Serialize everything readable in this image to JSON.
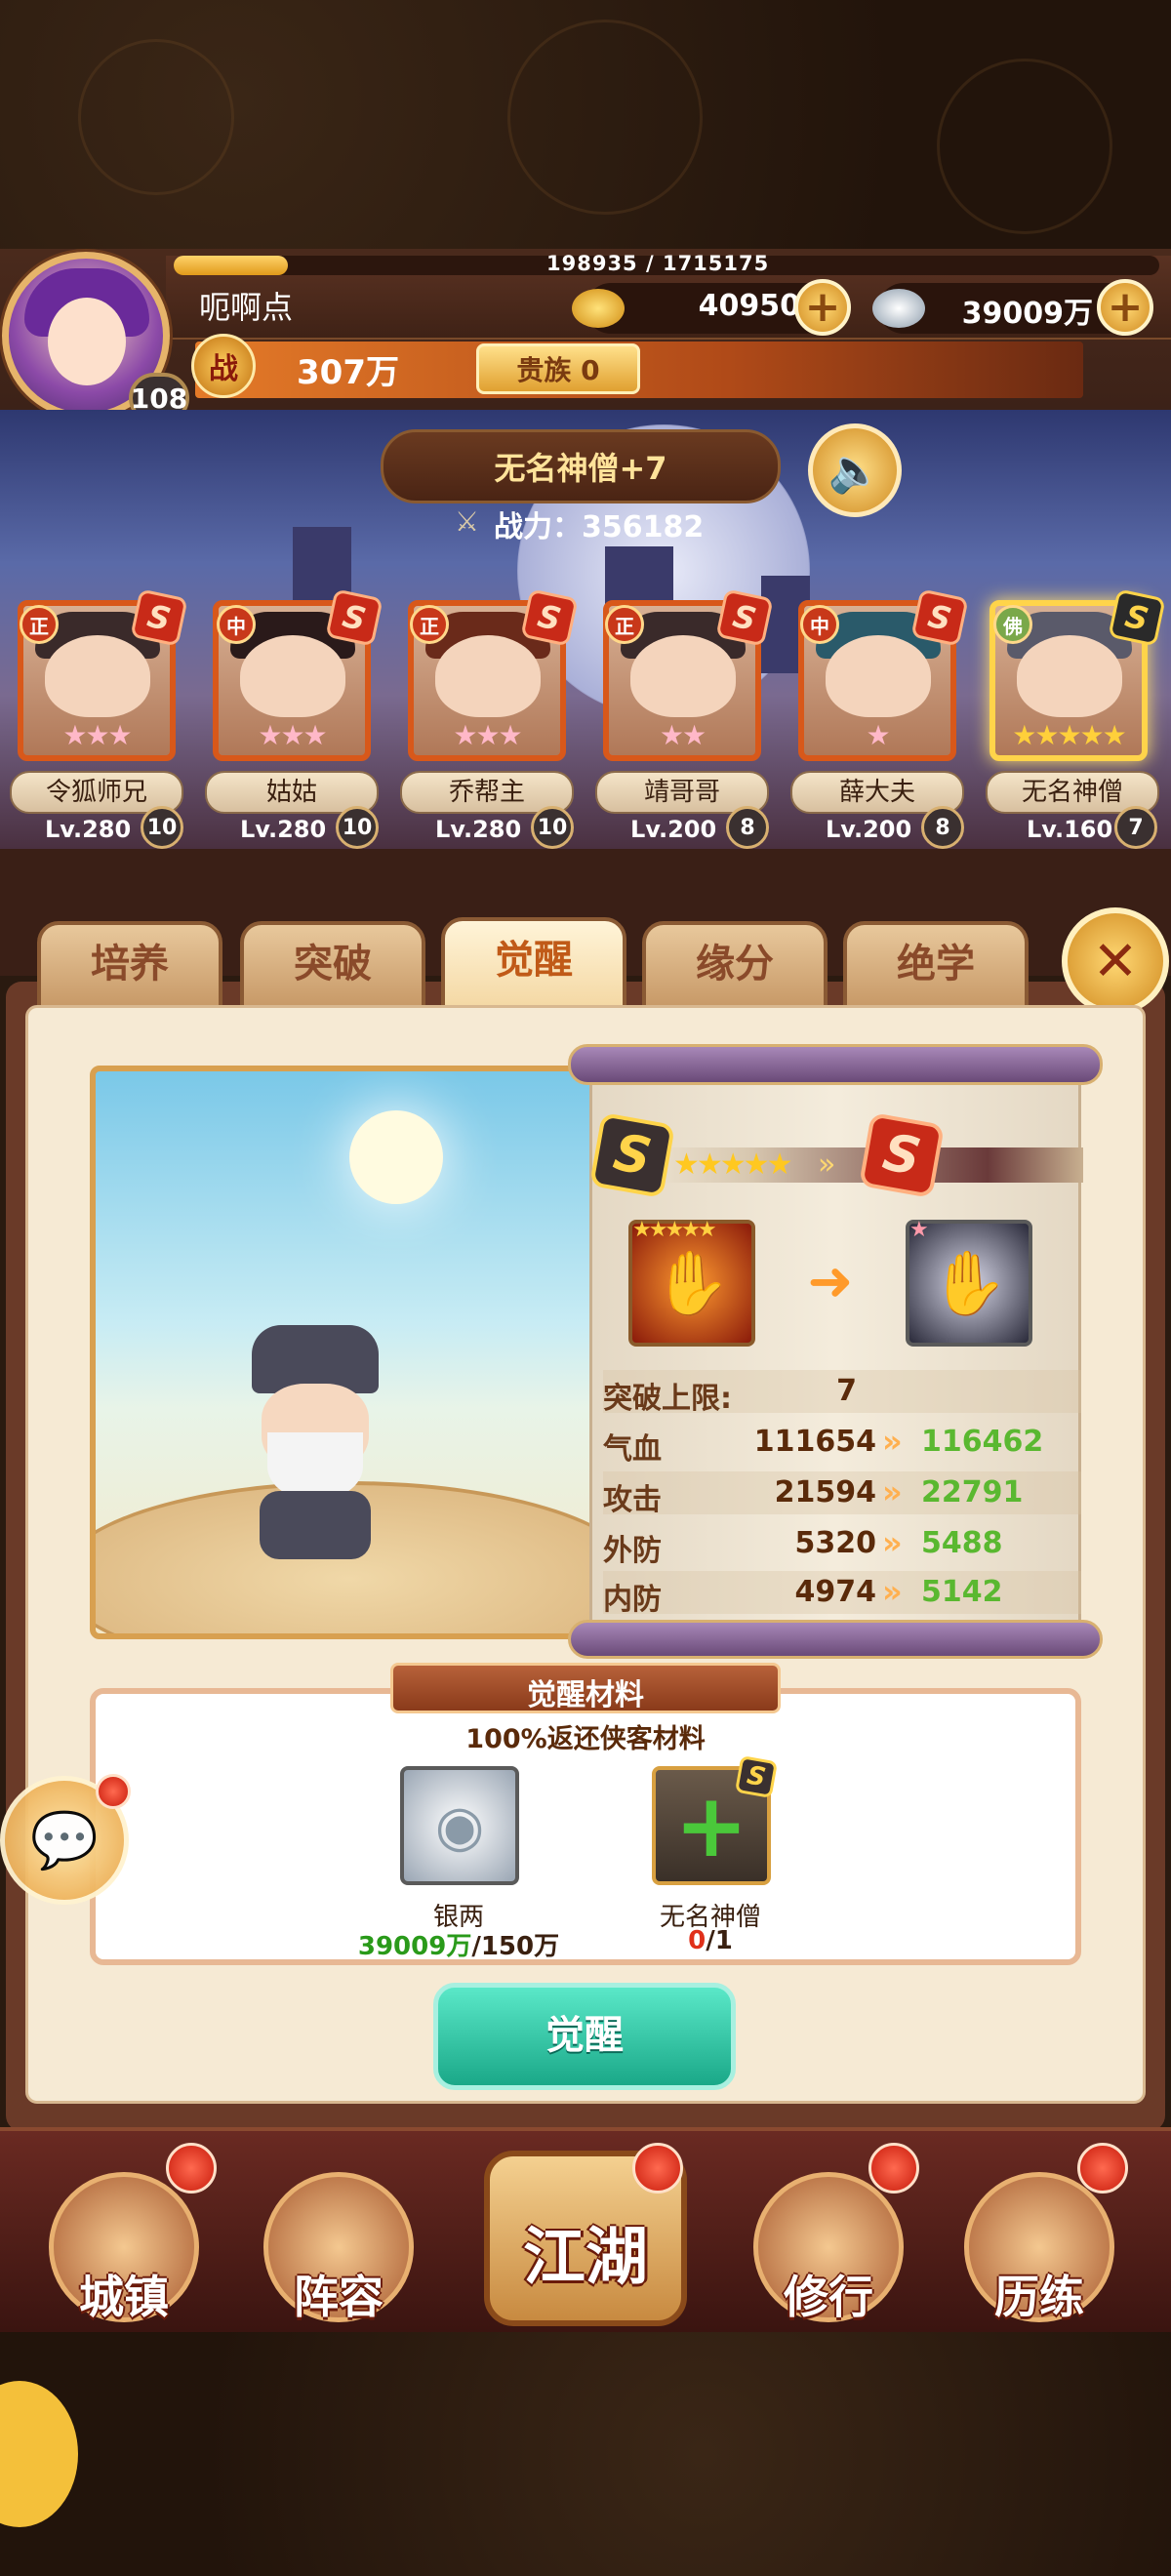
{
  "player": {
    "name": "呃啊点",
    "level": "108",
    "exp_text": "198935 / 1715175",
    "exp_fraction": 0.116,
    "power_icon": "战",
    "power": "307万",
    "noble": "贵族 0"
  },
  "currency": {
    "gold": "40950",
    "silver": "39009万",
    "gold_icon": "gold-ingot-icon",
    "silver_icon": "silver-ingot-icon",
    "plus": "+"
  },
  "selected_hero": {
    "title": "无名神僧+7",
    "power_label": "战力：356182"
  },
  "roster": [
    {
      "name": "令狐师兄",
      "faction": "正",
      "level": "Lv.280",
      "breakthrough": "10",
      "stars": "★★★",
      "grade": "S",
      "star_color": "pink"
    },
    {
      "name": "姑姑",
      "faction": "中",
      "level": "Lv.280",
      "breakthrough": "10",
      "stars": "★★★",
      "grade": "S",
      "star_color": "pink"
    },
    {
      "name": "乔帮主",
      "faction": "正",
      "level": "Lv.280",
      "breakthrough": "10",
      "stars": "★★★",
      "grade": "S",
      "star_color": "pink"
    },
    {
      "name": "靖哥哥",
      "faction": "正",
      "level": "Lv.200",
      "breakthrough": "8",
      "stars": "★★",
      "grade": "S",
      "star_color": "pink"
    },
    {
      "name": "薛大夫",
      "faction": "中",
      "level": "Lv.200",
      "breakthrough": "8",
      "stars": "★",
      "grade": "S",
      "star_color": "pink"
    },
    {
      "name": "无名神僧",
      "faction": "佛",
      "level": "Lv.160",
      "breakthrough": "7",
      "stars": "★★★★★",
      "grade": "S",
      "star_color": "gold"
    }
  ],
  "tabs": [
    "培养",
    "突破",
    "觉醒",
    "缘分",
    "绝学"
  ],
  "active_tab": "觉醒",
  "awaken": {
    "current_stars": "★★★★★",
    "item_icon_left": "buddha-palm-icon",
    "item_icon_right": "buddha-palm-icon",
    "stats": [
      {
        "label": "突破上限:",
        "current": "7",
        "next": ""
      },
      {
        "label": "气血",
        "current": "111654",
        "next": "116462"
      },
      {
        "label": "攻击",
        "current": "21594",
        "next": "22791"
      },
      {
        "label": "外防",
        "current": "5320",
        "next": "5488"
      },
      {
        "label": "内防",
        "current": "4974",
        "next": "5142"
      }
    ]
  },
  "materials": {
    "title": "觉醒材料",
    "subtitle": "100%返还侠客材料",
    "items": [
      {
        "name": "银两",
        "have": "39009万",
        "need": "/150万",
        "sufficient": true
      },
      {
        "name": "无名神僧",
        "have": "0",
        "need": "/1",
        "sufficient": false
      }
    ],
    "button": "觉醒"
  },
  "bottom_nav": [
    "城镇",
    "阵容",
    "江湖",
    "修行",
    "历练"
  ],
  "colors": {
    "accent_orange": "#d8581a",
    "panel_bg": "#f6ead4",
    "stat_green": "#5ab830",
    "button_teal": "#1aa888"
  }
}
